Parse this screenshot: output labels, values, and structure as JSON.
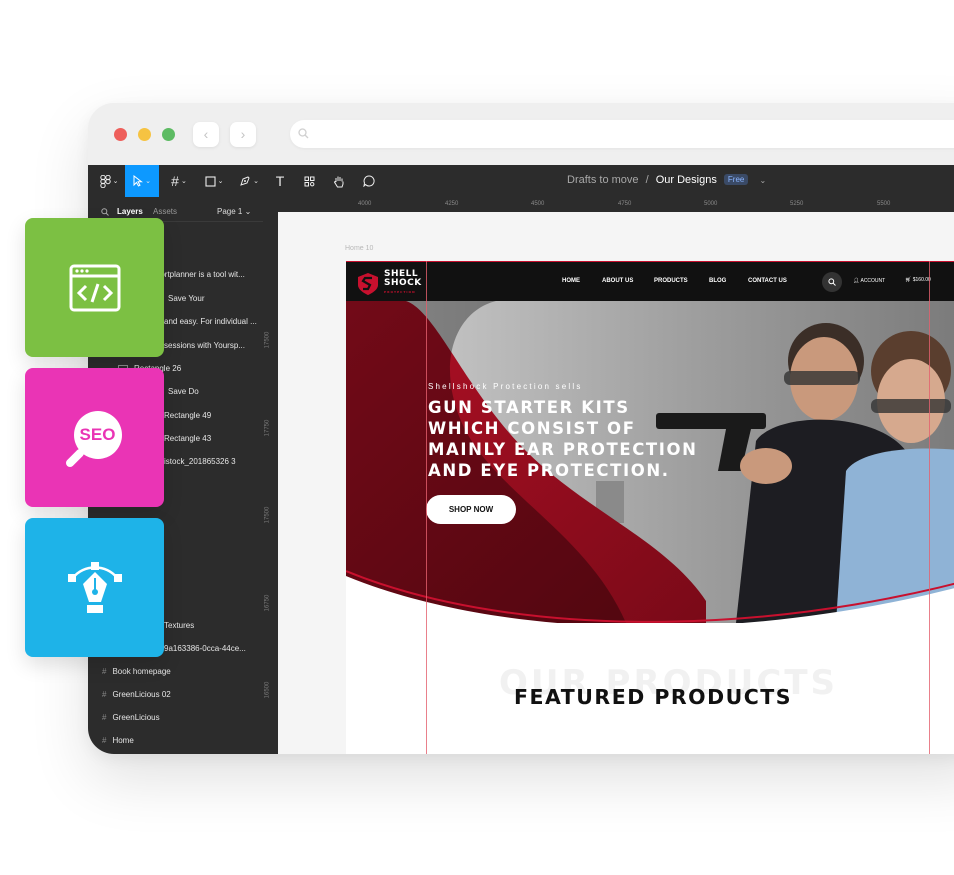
{
  "browser": {
    "traffic_lights": [
      "#ee5f5b",
      "#f6c342",
      "#5dbb63"
    ]
  },
  "toolbar": {
    "breadcrumb_parent": "Drafts to move",
    "separator": "/",
    "file_name": "Our Designs",
    "plan_badge": "Free",
    "accent": "#0d99ff"
  },
  "layers_panel": {
    "tab_layers": "Layers",
    "tab_assets": "Assets",
    "page_select": "Page 1",
    "items": [
      "Portplanner is a tool wit...",
      "Save Your",
      "and easy. For individual ...",
      "sessions with Yoursp...",
      "Rectangle 26",
      "Save Do",
      "Rectangle 49",
      "Rectangle 43",
      "istock_201865326 3",
      "Textures",
      "9a163386-0cca-44ce...",
      "Book homepage",
      "GreenLicious 02",
      "GreenLicious",
      "Home"
    ]
  },
  "rulers": {
    "horizontal": [
      "4000",
      "4250",
      "4500",
      "4750",
      "5000",
      "5250",
      "5500"
    ],
    "vertical": [
      "17500",
      "17750",
      "17500",
      "16750",
      "16500"
    ]
  },
  "frame_label": "Home 10",
  "site": {
    "logo_line1": "SHELL",
    "logo_line2": "SHOCK",
    "logo_line3": "PROTECTION",
    "nav": [
      "HOME",
      "ABOUT US",
      "PRODUCTS",
      "BLOG",
      "CONTACT US"
    ],
    "account": "ACCOUNT",
    "cart": "$160.00",
    "hero_subtitle": "Shellshock Protection sells",
    "hero_title_lines": [
      "GUN STARTER KITS",
      "WHICH CONSIST OF",
      "MAINLY EAR PROTECTION",
      "AND EYE PROTECTION."
    ],
    "cta": "SHOP NOW",
    "ghost_heading": "OUR PRODUCTS",
    "section_heading": "FEATURED PRODUCTS",
    "brand_red": "#c8102e"
  },
  "feature_cards": [
    {
      "icon": "code-window-icon",
      "color": "#7cc043"
    },
    {
      "icon": "seo-icon",
      "label": "SEO",
      "color": "#ea34b5"
    },
    {
      "icon": "pen-tool-icon",
      "color": "#1eb3e8"
    }
  ]
}
